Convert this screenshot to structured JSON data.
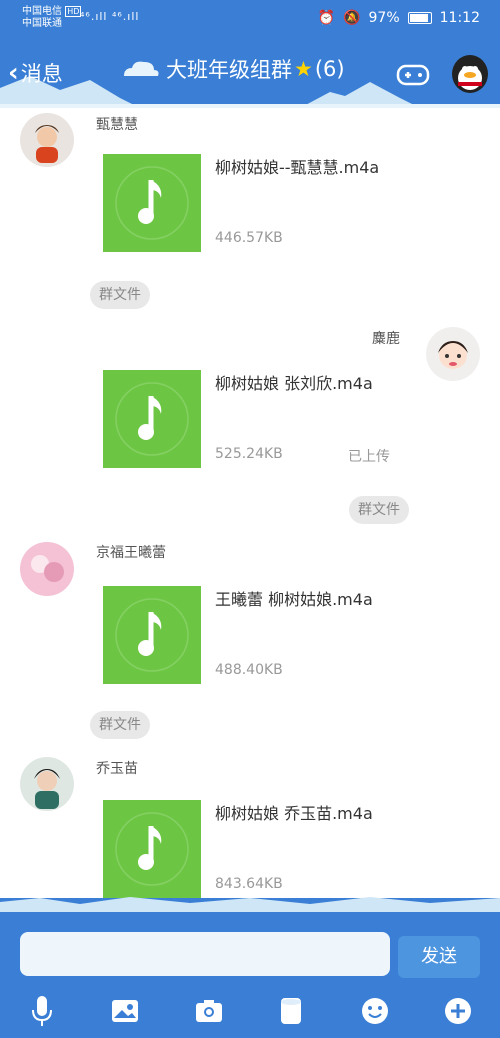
{
  "status_bar": {
    "carrier1": "中国电信",
    "carrier2": "中国联通",
    "hd": "HD",
    "signal": "⁴⁶.ıll ⁴⁶.ıll",
    "battery": "97%",
    "time": "11:12"
  },
  "header": {
    "back_label": "消息",
    "title": "大班年级组群",
    "member_count": "(6)"
  },
  "messages": [
    {
      "sender": "甄慧慧",
      "file_name": "柳树姑娘--甄慧慧.m4a",
      "file_size": "446.57KB",
      "tag": "群文件"
    },
    {
      "sender": "麋鹿",
      "file_name": "柳树姑娘   张刘欣.m4a",
      "file_size": "525.24KB",
      "status": "已上传",
      "tag": "群文件"
    },
    {
      "sender": "京福王曦蕾",
      "file_name": "王曦蕾 柳树姑娘.m4a",
      "file_size": "488.40KB",
      "tag": "群文件"
    },
    {
      "sender": "乔玉苗",
      "file_name": "柳树姑娘 乔玉苗.m4a",
      "file_size": "843.64KB"
    }
  ],
  "input": {
    "send_label": "发送"
  },
  "colors": {
    "theme_blue": "#3a7fd5",
    "file_green": "#6cc644"
  },
  "toolbar_icons": [
    "mic-icon",
    "image-icon",
    "camera-icon",
    "file-icon",
    "emoji-icon",
    "plus-icon"
  ]
}
